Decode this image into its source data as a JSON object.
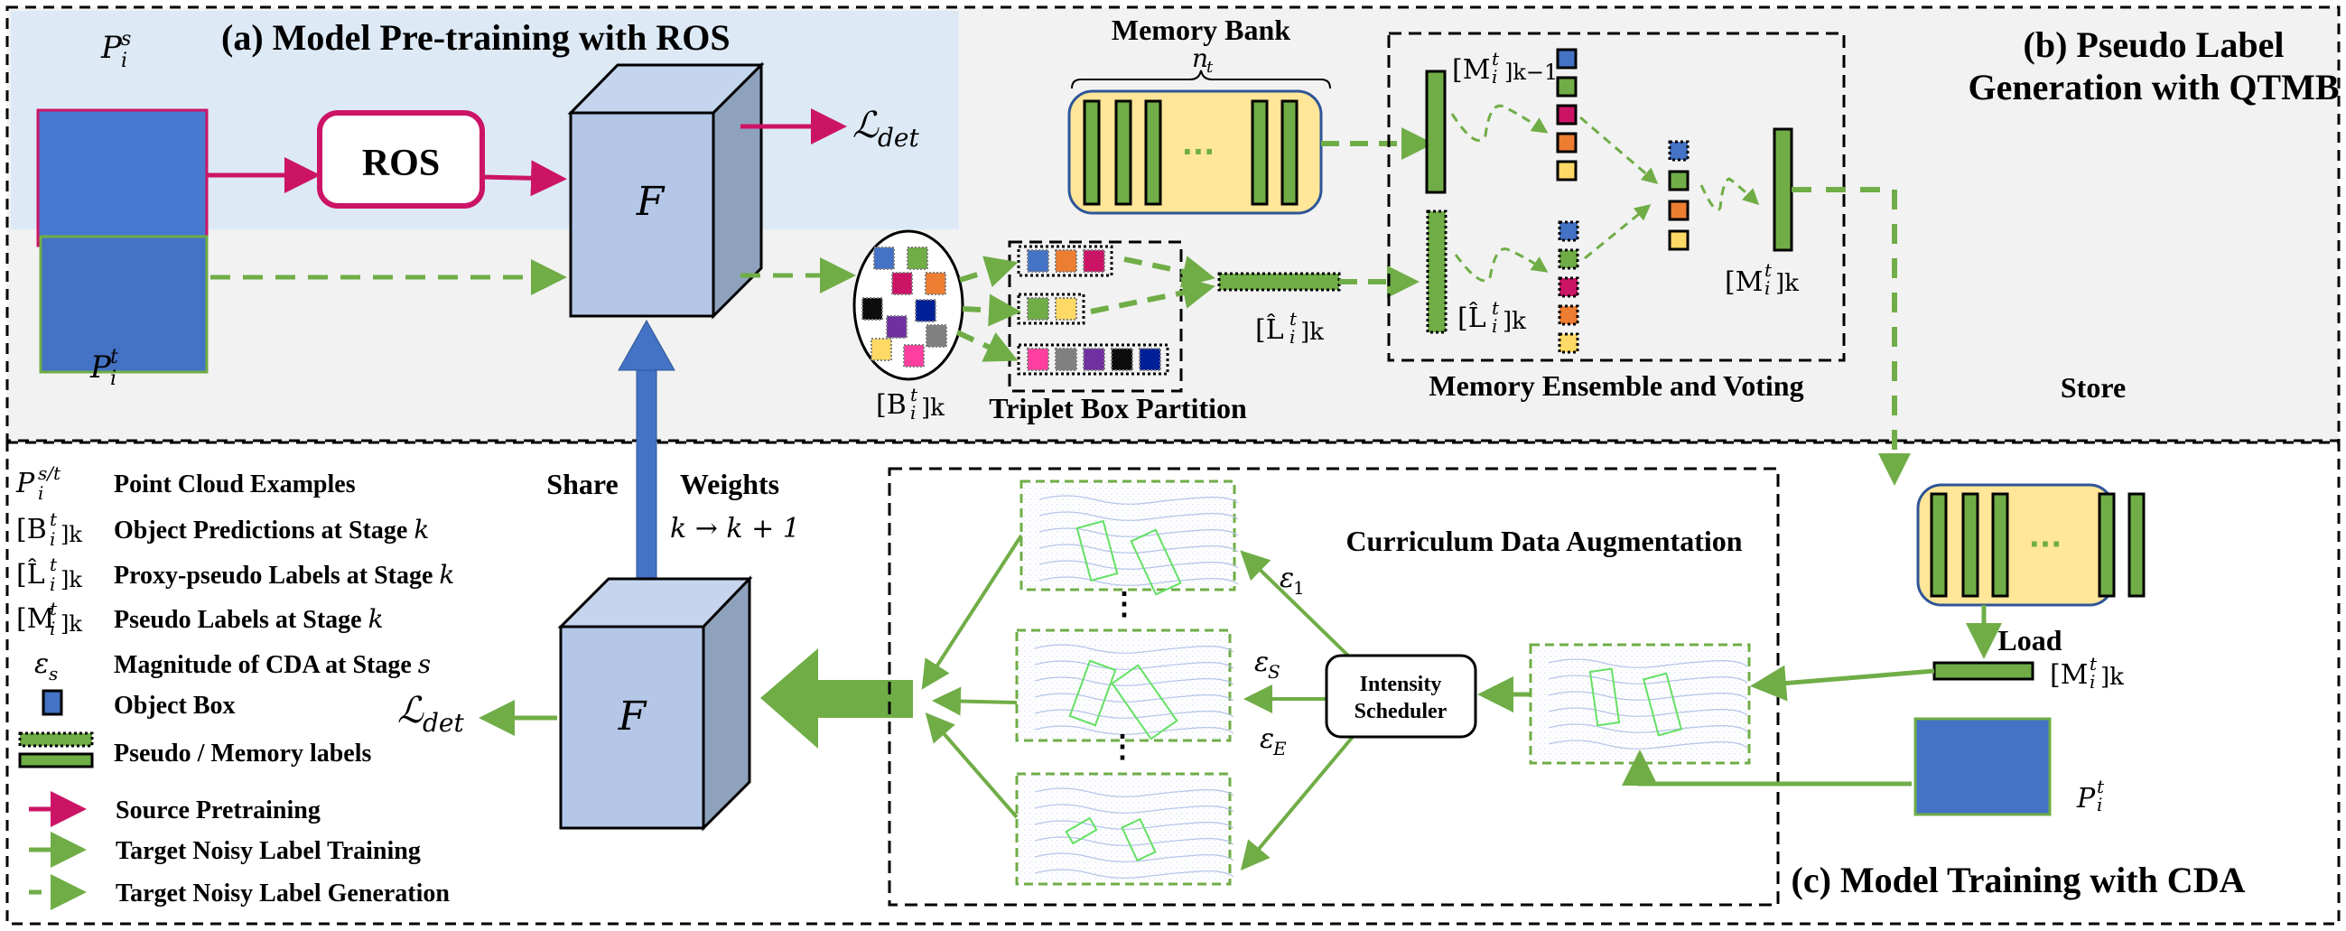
{
  "colors": {
    "green": "#70ad47",
    "pink": "#cc1466",
    "blue": "#4472c4",
    "box_face": "#b4c7e7",
    "box_top": "#c5d5ee",
    "box_side": "#8fa2bd",
    "panel_a_bg": "#ddeaf6",
    "panel_b_bg": "#f2f2f2",
    "memory_bank_bg": "#ffe699",
    "memory_bank_border": "#2f5597"
  },
  "sections": {
    "a_title": "(a) Model Pre-training with ROS",
    "b_title_line1": "(b) Pseudo Label",
    "b_title_line2": "Generation with QTMB",
    "c_title": "(c) Model Training with CDA"
  },
  "panel_a": {
    "source_label": "P",
    "source_sup": "s",
    "source_sub": "i",
    "target_label": "P",
    "target_sup": "t",
    "target_sub": "i",
    "ros_label": "ROS",
    "model_label": "F",
    "loss_label": "ℒ",
    "loss_sub": "det"
  },
  "panel_b": {
    "memory_bank_title": "Memory Bank",
    "memory_bank_size": "n",
    "memory_bank_size_sub": "t",
    "ellipsis": "···",
    "predictions_label": "[B",
    "predictions_sup": "t",
    "predictions_sub": "i",
    "predictions_suffix": "]k",
    "prediction_box_colors": [
      "#4472c4",
      "#70ad47",
      "#cc1466",
      "#ed7d31",
      "#0d0d0d",
      "#002097",
      "#7030a0",
      "#808080",
      "#ffd966",
      "#ff3f9f"
    ],
    "partition_title": "Triplet Box Partition",
    "partition_groups": [
      [
        "#4472c4",
        "#ed7d31",
        "#cc1466"
      ],
      [
        "#70ad47",
        "#ffd966"
      ],
      [
        "#ff3f9f",
        "#808080",
        "#7030a0",
        "#0d0d0d",
        "#002097"
      ]
    ],
    "proxy_label": "[L̂",
    "proxy_sup": "t",
    "proxy_sub": "i",
    "proxy_suffix": "]k",
    "prev_memory_label": "[M",
    "prev_memory_sup": "t",
    "prev_memory_sub": "i",
    "prev_memory_suffix": "]k−1",
    "prev_memory_colors": [
      "#4472c4",
      "#70ad47",
      "#cc1466",
      "#ed7d31",
      "#ffd966"
    ],
    "proxy_colors": [
      "#4472c4",
      "#70ad47",
      "#cc1466",
      "#ed7d31",
      "#ffd966"
    ],
    "voted_colors": [
      "#4472c4",
      "#70ad47",
      "#ed7d31",
      "#ffd966"
    ],
    "memory_out_label": "[M",
    "memory_out_sup": "t",
    "memory_out_sub": "i",
    "memory_out_suffix": "]k",
    "ensemble_title": "Memory Ensemble and Voting",
    "store_label": "Store"
  },
  "share": {
    "share_label": "Share",
    "weights_label": "Weights",
    "stage_step": "k  → k + 1"
  },
  "panel_c": {
    "model_label": "F",
    "loss_label": "ℒ",
    "loss_sub": "det",
    "cda_title": "Curriculum Data Augmentation",
    "scheduler_line1": "Intensity",
    "scheduler_line2": "Scheduler",
    "eps_1": "ε",
    "eps_1_sub": "1",
    "eps_s": "ε",
    "eps_s_sub": "S",
    "eps_e": "ε",
    "eps_e_sub": "E",
    "vdots": "⋮",
    "load_label": "Load",
    "memory_label": "[M",
    "memory_sup": "t",
    "memory_sub": "i",
    "memory_suffix": "]k",
    "target_label": "P",
    "target_sup": "t",
    "target_sub": "i"
  },
  "legend": {
    "items": [
      {
        "sym": "P",
        "sup": "s/t",
        "sub": "i",
        "suffix": "",
        "text": "Point Cloud Examples"
      },
      {
        "sym": "[B",
        "sup": "t",
        "sub": "i",
        "suffix": "]k",
        "text": "Object Predictions at Stage",
        "text_ital": "k"
      },
      {
        "sym": "[L̂",
        "sup": "t",
        "sub": "i",
        "suffix": "]k",
        "text": "Proxy-pseudo Labels at Stage",
        "text_ital": "k"
      },
      {
        "sym": "[M",
        "sup": "t",
        "sub": "i",
        "suffix": "]k",
        "text": "Pseudo Labels at Stage",
        "text_ital": "k"
      },
      {
        "sym": "ε",
        "sup": "",
        "sub": "s",
        "suffix": "",
        "text": "Magnitude of CDA at Stage",
        "text_ital": "s"
      }
    ],
    "object_box": "Object Box",
    "pseudo_memory": "Pseudo / Memory labels",
    "source_pretraining": "Source Pretraining",
    "target_training": "Target Noisy Label Training",
    "target_generation": "Target Noisy Label Generation"
  }
}
